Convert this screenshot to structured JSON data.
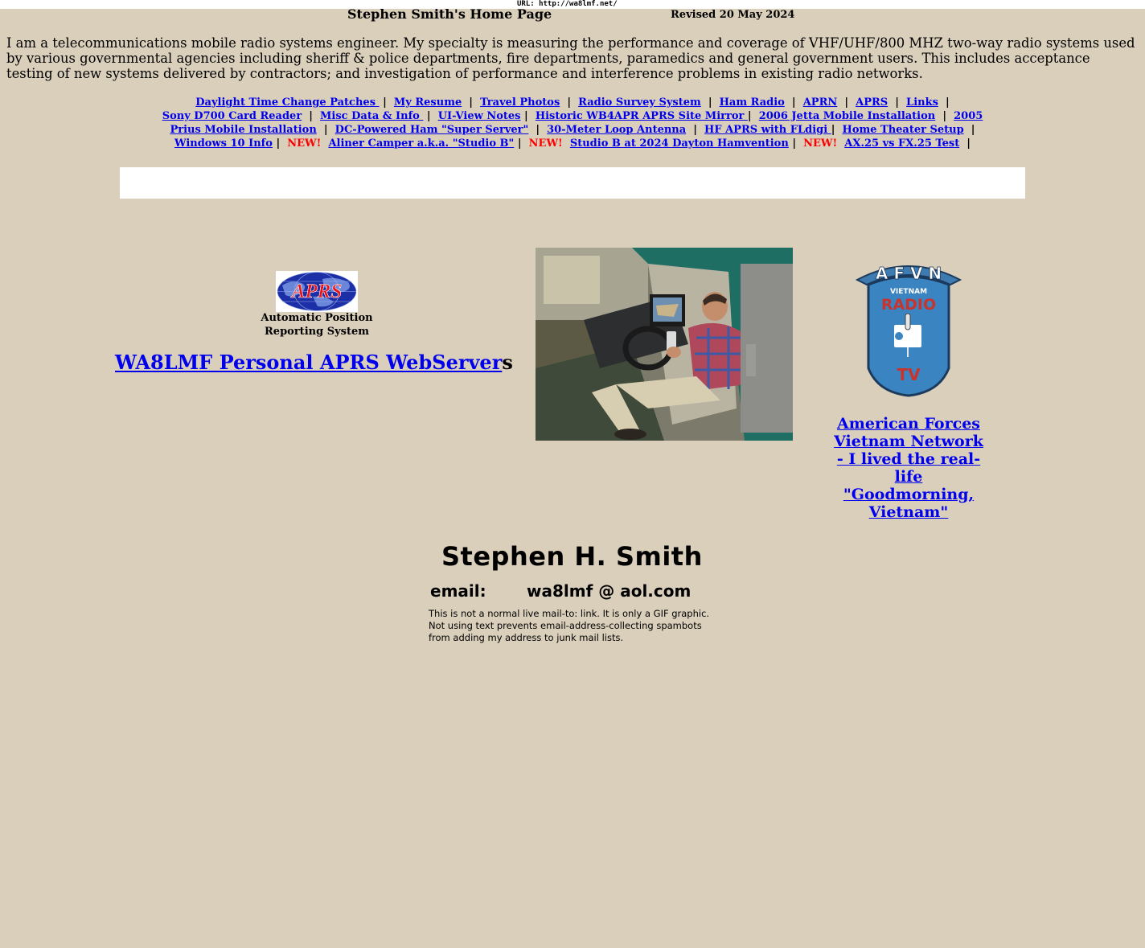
{
  "header": {
    "url_graphic": "URL: http://wa8lmf.net/",
    "title": "Stephen Smith's Home Page",
    "revised": "Revised  20 May 2024"
  },
  "intro": "I am a telecommunications mobile radio systems engineer. My specialty is measuring the performance and coverage of VHF/UHF/800 MHZ two-way radio systems used by various governmental agencies including sheriff & police departments, fire departments, paramedics and general government users. This includes acceptance testing of new systems delivered by contractors; and investigation of performance and interference problems in existing radio networks.",
  "nav": {
    "separator": "|",
    "new_label": "NEW!",
    "links": {
      "dst": "Daylight Time Change Patches ",
      "resume": "My Resume",
      "travel": "Travel Photos",
      "survey": "Radio Survey System",
      "ham": "Ham Radio",
      "aprn": "APRN",
      "aprs": "APRS",
      "links": "Links",
      "sony": "Sony D700 Card Reader",
      "misc": "Misc Data & Info ",
      "uiview": "UI-View Notes",
      "mirror": "Historic WB4APR APRS Site Mirror ",
      "jetta": "2006 Jetta Mobile Installation",
      "prius_year": "2005",
      "prius": "Prius Mobile Installation",
      "server": "DC-Powered Ham \"Super Server\"",
      "loop": "30-Meter Loop Antenna",
      "hfaprs": "HF APRS with FLdigi ",
      "theater": "Home Theater Setup",
      "win10": "Windows 10 Info",
      "camper": "Aliner Camper a.k.a. \"Studio B\"",
      "dayton": "Studio B at 2024 Dayton Hamvention",
      "ax25": "AX.25 vs FX.25 Test"
    }
  },
  "aprs": {
    "logo_text": "APRS",
    "caption_line1": "Automatic Position",
    "caption_line2": "Reporting System",
    "webserver_link": " WA8LMF Personal APRS WebServer",
    "webserver_suffix": "s"
  },
  "afvn": {
    "logo_top": "A F V N",
    "logo_vietnam": "VIETNAM",
    "logo_radio": "RADIO",
    "logo_tv": "TV",
    "link_text": "American Forces Vietnam Network - I lived the real-life \"Goodmorning, Vietnam\""
  },
  "signature": {
    "name": "Stephen H. Smith",
    "email_label": "email:",
    "email_value": "wa8lmf @ aol.com",
    "note_lines": [
      "This is not a normal live mail-to: link. It is only a GIF graphic.",
      "Not using text prevents email-address-collecting spambots",
      "from adding my address to junk mail lists."
    ]
  },
  "colors": {
    "background": "#d9cfbb",
    "link": "#0000ee",
    "new_badge": "#ff0000"
  }
}
